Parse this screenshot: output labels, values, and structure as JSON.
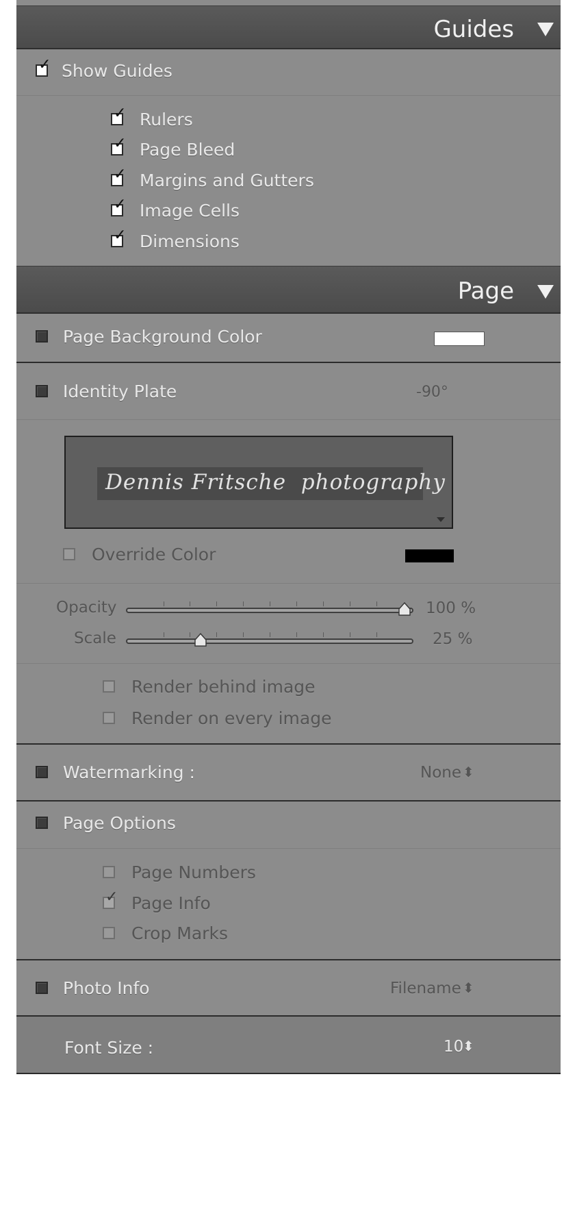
{
  "guides": {
    "title": "Guides",
    "show_guides": {
      "label": "Show Guides",
      "checked": true
    },
    "options": [
      {
        "label": "Rulers",
        "checked": true
      },
      {
        "label": "Page Bleed",
        "checked": true
      },
      {
        "label": "Margins and Gutters",
        "checked": true
      },
      {
        "label": "Image Cells",
        "checked": true
      },
      {
        "label": "Dimensions",
        "checked": true
      }
    ]
  },
  "page": {
    "title": "Page",
    "background_color": {
      "label": "Page Background Color",
      "checked": false,
      "swatch": "#ffffff"
    },
    "identity_plate": {
      "label": "Identity Plate",
      "checked": false,
      "rotation": "-90°",
      "plate_text": "Dennis Fritsche  photography",
      "override_color": {
        "label": "Override Color",
        "checked": false,
        "swatch": "#000000"
      },
      "opacity": {
        "label": "Opacity",
        "value_text": "100 %",
        "value": 100
      },
      "scale": {
        "label": "Scale",
        "value_text": "25 %",
        "value": 25
      },
      "render_behind": {
        "label": "Render behind image",
        "checked": false
      },
      "render_every": {
        "label": "Render on every image",
        "checked": false
      }
    },
    "watermarking": {
      "label": "Watermarking :",
      "checked": false,
      "value": "None"
    },
    "page_options": {
      "label": "Page Options",
      "checked": false,
      "items": [
        {
          "label": "Page Numbers",
          "checked": false
        },
        {
          "label": "Page Info",
          "checked": true
        },
        {
          "label": "Crop Marks",
          "checked": false
        }
      ]
    },
    "photo_info": {
      "label": "Photo Info",
      "checked": false,
      "value": "Filename"
    },
    "font_size": {
      "label": "Font Size :",
      "value": "10"
    }
  },
  "icons": {
    "collapse": "triangle-down-icon",
    "checkmark": "checkmark-icon",
    "stepper": "up-down-arrows-icon"
  }
}
